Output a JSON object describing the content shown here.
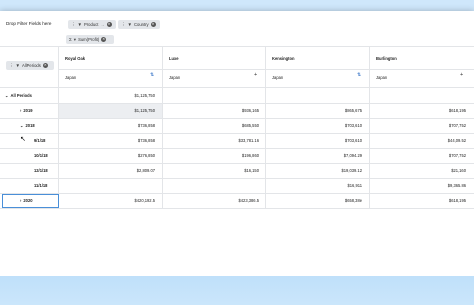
{
  "drop_filter_label": "Drop Filter Fields here",
  "filter_chips": [
    {
      "label": "Product",
      "arrow": "→"
    },
    {
      "label": "Country"
    }
  ],
  "value_chip": {
    "label": "Sum(Profit)"
  },
  "rows_chip": {
    "label": "AllPeriods"
  },
  "columns": [
    {
      "city": "Royal Oak",
      "country": "Japan"
    },
    {
      "city": "Luxe",
      "country": "Japan"
    },
    {
      "city": "Kensington",
      "country": "Japan"
    },
    {
      "city": "Burlington",
      "country": "Japan"
    }
  ],
  "rows": [
    {
      "label": "All Periods",
      "caret": "⌄",
      "bold": true,
      "values": [
        "",
        "",
        "",
        ""
      ]
    },
    {
      "label": "2019",
      "caret": "›",
      "bold": false,
      "values": [
        "$1,125,750",
        "$936,165",
        "$865,675",
        "$618,195"
      ]
    },
    {
      "label": "2018",
      "caret": "⌄",
      "bold": false,
      "values": [
        "$736,858",
        "$685,550",
        "$703,610",
        "$707,752"
      ]
    },
    {
      "label": "9/1/18",
      "caret": "",
      "bold": false,
      "values": [
        "$736,858",
        "$33,781.16",
        "$703,610",
        "$44,09.52"
      ]
    },
    {
      "label": "10/1/18",
      "caret": "",
      "bold": false,
      "values": [
        "$276,850",
        "$196,860",
        "$7,094.29",
        "$707,752"
      ]
    },
    {
      "label": "12/1/18",
      "caret": "",
      "bold": false,
      "values": [
        "$2,809.07",
        "$16,150",
        "$19,039.12",
        "$21,160"
      ]
    },
    {
      "label": "11/1/18",
      "caret": "",
      "bold": false,
      "values": [
        "",
        "",
        "$16,911",
        "$9,365.86"
      ]
    },
    {
      "label": "2020",
      "caret": "›",
      "bold": false,
      "values": [
        "$420,192.5",
        "$423,386.5",
        "$658,38e",
        "$618,195"
      ]
    }
  ],
  "header_value_col1": "$1,125,750",
  "icons": {
    "filter": "filter-icon",
    "remove": "remove-chip-icon",
    "sort": "sort-icon",
    "add": "add-icon"
  }
}
